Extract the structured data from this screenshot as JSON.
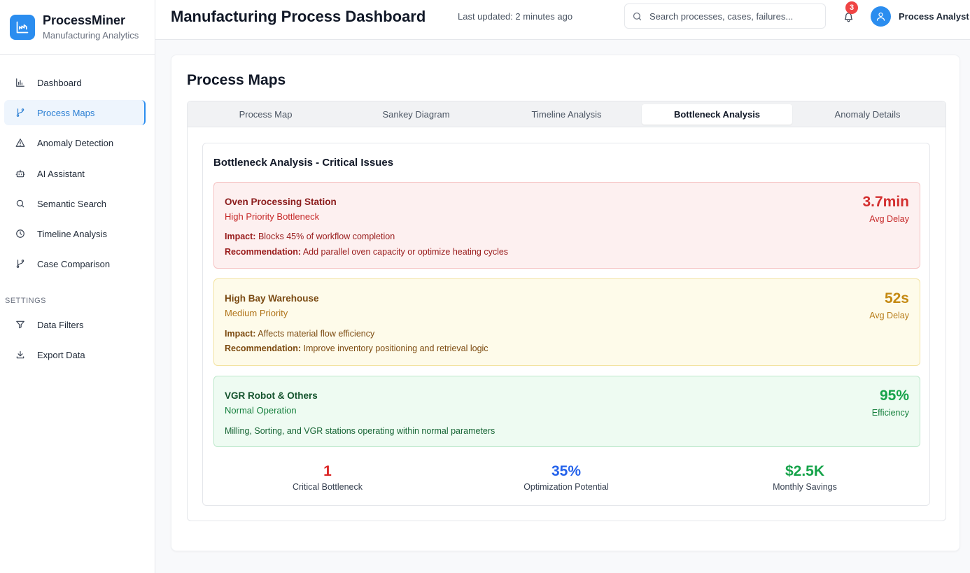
{
  "brand": {
    "title": "ProcessMiner",
    "subtitle": "Manufacturing Analytics"
  },
  "sidebar": {
    "items": [
      {
        "label": "Dashboard",
        "icon": "bar-chart-icon"
      },
      {
        "label": "Process Maps",
        "icon": "git-branch-icon",
        "active": true
      },
      {
        "label": "Anomaly Detection",
        "icon": "warning-triangle-icon"
      },
      {
        "label": "AI Assistant",
        "icon": "robot-icon"
      },
      {
        "label": "Semantic Search",
        "icon": "search-icon"
      },
      {
        "label": "Timeline Analysis",
        "icon": "clock-icon"
      },
      {
        "label": "Case Comparison",
        "icon": "git-branch-icon"
      }
    ],
    "settings_label": "SETTINGS",
    "settings_items": [
      {
        "label": "Data Filters",
        "icon": "filter-icon"
      },
      {
        "label": "Export Data",
        "icon": "download-icon"
      }
    ]
  },
  "header": {
    "title": "Manufacturing Process Dashboard",
    "last_updated": "Last updated: 2 minutes ago",
    "search_placeholder": "Search processes, cases, failures...",
    "notification_count": "3",
    "user_name": "Process Analyst"
  },
  "main": {
    "section_title": "Process Maps",
    "tabs": [
      {
        "label": "Process Map"
      },
      {
        "label": "Sankey Diagram"
      },
      {
        "label": "Timeline Analysis"
      },
      {
        "label": "Bottleneck Analysis",
        "active": true
      },
      {
        "label": "Anomaly Details"
      }
    ],
    "panel_title": "Bottleneck Analysis - Critical Issues",
    "issues": [
      {
        "name": "Oven Processing Station",
        "priority": "High Priority Bottleneck",
        "impact_label": "Impact:",
        "impact": "Blocks 45% of workflow completion",
        "recommendation_label": "Recommendation:",
        "recommendation": "Add parallel oven capacity or optimize heating cycles",
        "metric": "3.7min",
        "metric_label": "Avg Delay",
        "status_color": "#d32f2f"
      },
      {
        "name": "High Bay Warehouse",
        "priority": "Medium Priority",
        "impact_label": "Impact:",
        "impact": "Affects material flow efficiency",
        "recommendation_label": "Recommendation:",
        "recommendation": "Improve inventory positioning and retrieval logic",
        "metric": "52s",
        "metric_label": "Avg Delay",
        "status_color": "#c58a14"
      },
      {
        "name": "VGR Robot & Others",
        "priority": "Normal Operation",
        "description": "Milling, Sorting, and VGR stations operating within normal parameters",
        "metric": "95%",
        "metric_label": "Efficiency",
        "status_color": "#16a34a"
      }
    ],
    "stats": [
      {
        "value": "1",
        "label": "Critical Bottleneck",
        "color": "#dc2626"
      },
      {
        "value": "35%",
        "label": "Optimization Potential",
        "color": "#2563eb"
      },
      {
        "value": "$2.5K",
        "label": "Monthly Savings",
        "color": "#16a34a"
      }
    ]
  },
  "colors": {
    "accent": "#2b8def",
    "badge": "#ef4444"
  }
}
